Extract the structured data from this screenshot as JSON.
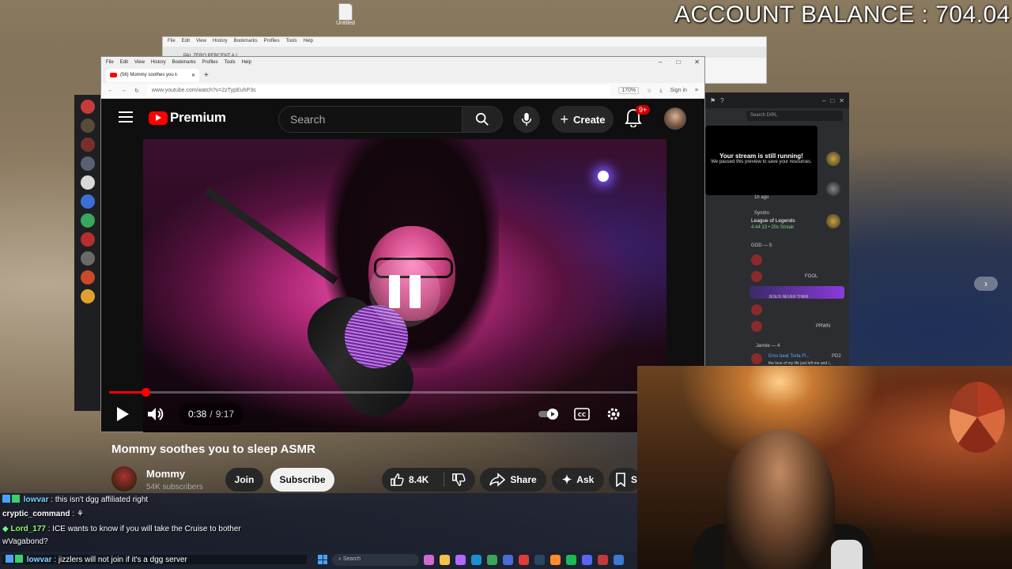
{
  "overlay": {
    "balance": "ACCOUNT BALANCE : 704.04"
  },
  "desktop": {
    "icon_label": "Untitled"
  },
  "back_browser": {
    "menu": [
      "File",
      "Edit",
      "View",
      "History",
      "Bookmarks",
      "Profiles",
      "Tools",
      "Help"
    ],
    "tab_title": "PAL ZERO PERCENT A.I."
  },
  "browser": {
    "menu": [
      "File",
      "Edit",
      "View",
      "History",
      "Bookmarks",
      "Profiles",
      "Tools",
      "Help"
    ],
    "tab_title": "(56) Mommy soothes you t̶",
    "url": "www.youtube.com/watch?v=2zTypEuhP3s",
    "zoom": "170%",
    "signin": "Sign in"
  },
  "youtube": {
    "logo_text": "Premium",
    "search_placeholder": "Search",
    "create_label": "Create",
    "notif_badge": "9+",
    "video": {
      "current_time": "0:38",
      "separator": "/",
      "duration": "9:17",
      "progress_fraction": 0.068,
      "title": "Mommy soothes you to sleep ASMR"
    },
    "channel": {
      "name": "Mommy",
      "subscribers": "54K subscribers"
    },
    "actions": {
      "join": "Join",
      "subscribe": "Subscribe",
      "likes": "8.4K",
      "share": "Share",
      "ask": "Ask",
      "save": "S"
    }
  },
  "discord": {
    "search_placeholder": "Search DIRL",
    "popup_title": "Your stream is still running!",
    "popup_text": "We paused this preview to save your resources.",
    "time_ago": "1h ago",
    "activity_user": "Syndro",
    "activity_game": "League of Legends",
    "activity_detail": "4:44:13 • 20x Streak",
    "section_god": "GOD — 5",
    "section_jannie": "Jannie — 4",
    "member_note": "JESUS NEVER THEM",
    "member_tag_fool": "FOOL",
    "member_tag_prwn": "PRWN",
    "member_tag_pd2": "PD2",
    "member_last": "Eros beat Torta Fl...",
    "member_last_sub": "the love of my life just left me and i..."
  },
  "chat": [
    {
      "user": "lowvar",
      "text": "this isn't dgg affiliated right",
      "color": "#7fd3ff"
    },
    {
      "user": "cryptic_command",
      "text": "",
      "color": "#ffffff"
    },
    {
      "user": "Lord_177",
      "text": "ICE wants to know if you will take the Cruise to bother",
      "color": "#8bff6b"
    },
    {
      "user": "",
      "text": "wVagabond?",
      "color": "#ffffff"
    }
  ],
  "chat_last": {
    "user": "lowvar",
    "text": "jizzlers will not join if it's a dgg server"
  },
  "taskbar": {
    "search_placeholder": "Search"
  },
  "colors": {
    "yt_red": "#ff0000",
    "accent_blue": "#4aa3ff"
  }
}
